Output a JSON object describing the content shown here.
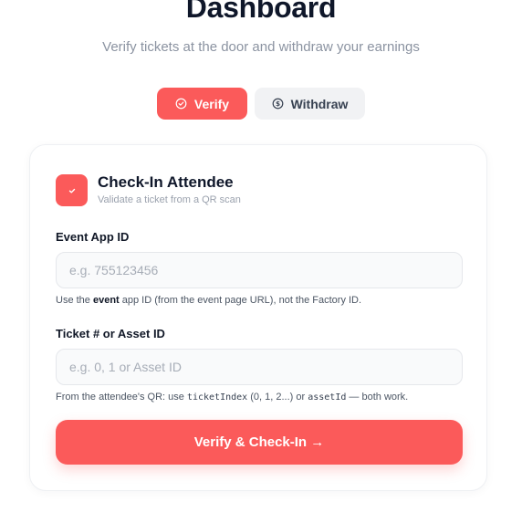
{
  "header": {
    "title": "Dashboard",
    "subtitle": "Verify tickets at the door and withdraw your earnings"
  },
  "tabs": [
    {
      "label": "Verify",
      "icon": "check-circle-icon",
      "active": true
    },
    {
      "label": "Withdraw",
      "icon": "dollar-circle-icon",
      "active": false
    }
  ],
  "card": {
    "icon": "check-icon",
    "title": "Check-In Attendee",
    "subtitle": "Validate a ticket from a QR scan",
    "event_field": {
      "label": "Event App ID",
      "placeholder": "e.g. 755123456",
      "value": "",
      "help_prefix": "Use the ",
      "help_bold": "event",
      "help_suffix": " app ID (from the event page URL), not the Factory ID."
    },
    "ticket_field": {
      "label": "Ticket # or Asset ID",
      "placeholder": "e.g. 0, 1 or Asset ID",
      "value": "",
      "help_prefix": "From the attendee's QR: use ",
      "help_code1": "ticketIndex",
      "help_mid": " (0, 1, 2...) or ",
      "help_code2": "assetId",
      "help_suffix": " — both work."
    },
    "submit_label": "Verify & Check-In →"
  },
  "colors": {
    "accent": "#fb5a5a",
    "inactive_tab": "#f1f2f4",
    "title": "#0f172a",
    "muted": "#8b93a1"
  }
}
